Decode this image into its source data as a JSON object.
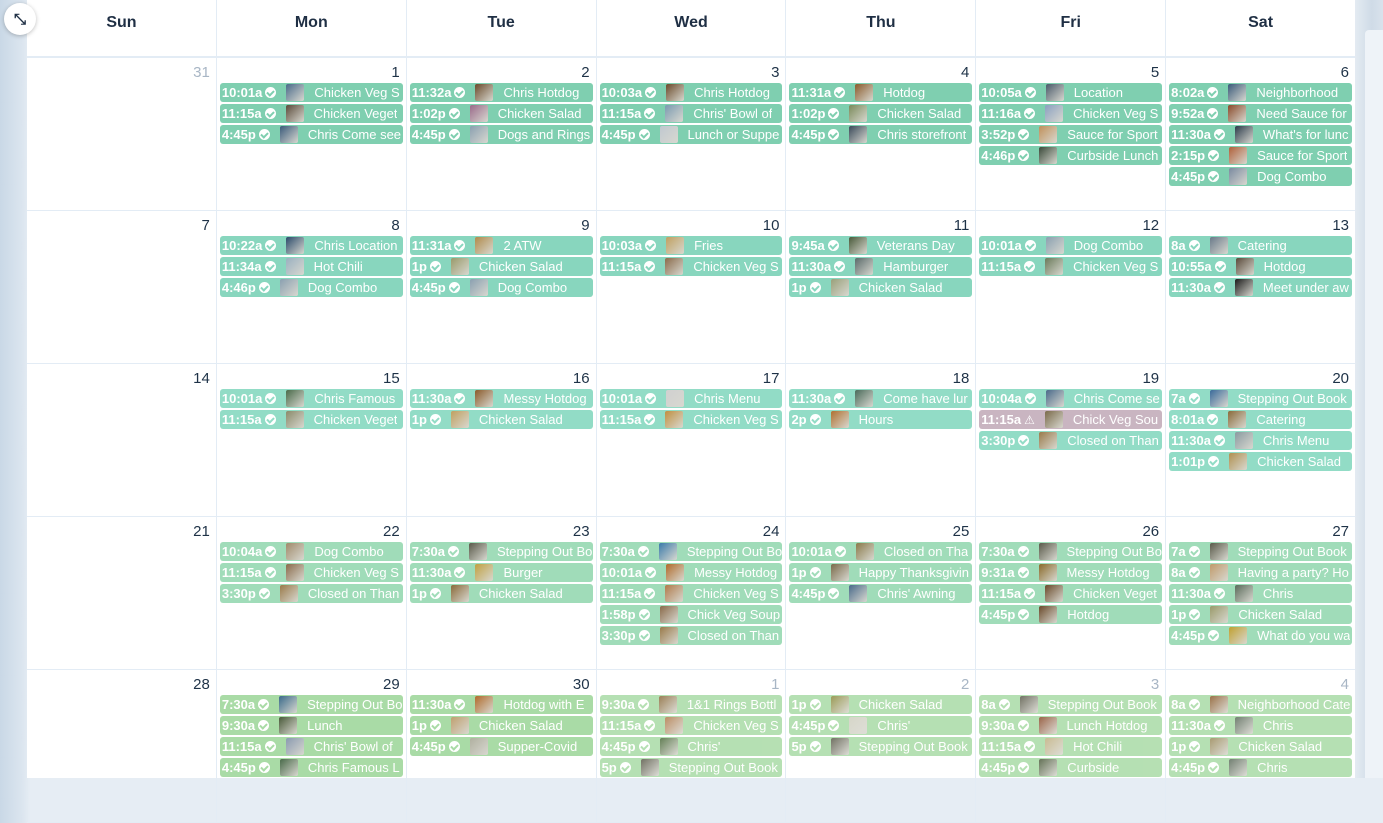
{
  "weekdays": [
    "Sun",
    "Mon",
    "Tue",
    "Wed",
    "Thu",
    "Fri",
    "Sat"
  ],
  "expand_icon": "⤡",
  "colors": {
    "week1": "#7fcfb0",
    "week2": "#88d6be",
    "week3": "#92dcc6",
    "week4": "#a0dcb9",
    "week5": "#a9dba6",
    "warning": "#c9b5c1"
  },
  "weeks": [
    {
      "days": [
        {
          "num": "31",
          "other": true,
          "events": []
        },
        {
          "num": "1",
          "events": [
            {
              "time": "10:01a",
              "status": "ok",
              "name": "Chicken Veg S",
              "thumb": "#4a6a8a"
            },
            {
              "time": "11:15a",
              "status": "ok",
              "name": "Chicken Veget",
              "thumb": "#5a4a3a"
            },
            {
              "time": "4:45p",
              "status": "ok",
              "name": "Chris Come see",
              "thumb": "#3a5a7a"
            }
          ]
        },
        {
          "num": "2",
          "events": [
            {
              "time": "11:32a",
              "status": "ok",
              "name": "Chris Hotdog",
              "thumb": "#6a4a2a"
            },
            {
              "time": "1:02p",
              "status": "ok",
              "name": "Chicken Salad",
              "thumb": "#9a6a8a"
            },
            {
              "time": "4:45p",
              "status": "ok",
              "name": "Dogs and Rings",
              "thumb": "#8aa0b0"
            }
          ]
        },
        {
          "num": "3",
          "events": [
            {
              "time": "10:03a",
              "status": "ok",
              "name": "Chris Hotdog",
              "thumb": "#6a4a2a"
            },
            {
              "time": "11:15a",
              "status": "ok",
              "name": "Chris' Bowl of",
              "thumb": "#7a9ab0"
            },
            {
              "time": "4:45p",
              "status": "ok",
              "name": "Lunch or Suppe",
              "thumb": "#c0c8d0"
            }
          ]
        },
        {
          "num": "4",
          "events": [
            {
              "time": "11:31a",
              "status": "ok",
              "name": "Hotdog",
              "thumb": "#8a5a2a"
            },
            {
              "time": "1:02p",
              "status": "ok",
              "name": "Chicken Salad",
              "thumb": "#7a8a5a"
            },
            {
              "time": "4:45p",
              "status": "ok",
              "name": "Chris storefront",
              "thumb": "#3a4a5a"
            }
          ]
        },
        {
          "num": "5",
          "events": [
            {
              "time": "10:05a",
              "status": "ok",
              "name": "Location",
              "thumb": "#4a5a6a"
            },
            {
              "time": "11:16a",
              "status": "ok",
              "name": "Chicken Veg S",
              "thumb": "#8aa0c0"
            },
            {
              "time": "3:52p",
              "status": "ok",
              "name": "Sauce for Sport",
              "thumb": "#c0905a"
            },
            {
              "time": "4:46p",
              "status": "ok",
              "name": "Curbside Lunch",
              "thumb": "#3a4a3a"
            }
          ]
        },
        {
          "num": "6",
          "events": [
            {
              "time": "8:02a",
              "status": "ok",
              "name": "Neighborhood",
              "thumb": "#3a5a7a"
            },
            {
              "time": "9:52a",
              "status": "ok",
              "name": "Need Sauce for",
              "thumb": "#8a4a2a"
            },
            {
              "time": "11:30a",
              "status": "ok",
              "name": "What's for lunc",
              "thumb": "#2a3a4a"
            },
            {
              "time": "2:15p",
              "status": "ok",
              "name": "Sauce for Sport",
              "thumb": "#b0603a"
            },
            {
              "time": "4:45p",
              "status": "ok",
              "name": "Dog Combo",
              "thumb": "#7a8aa0"
            }
          ]
        }
      ]
    },
    {
      "days": [
        {
          "num": "7",
          "events": []
        },
        {
          "num": "8",
          "events": [
            {
              "time": "10:22a",
              "status": "ok",
              "name": "Chris Location",
              "thumb": "#2a4a6a"
            },
            {
              "time": "11:34a",
              "status": "ok",
              "name": "Hot Chili",
              "thumb": "#9ab0c0"
            },
            {
              "time": "4:46p",
              "status": "ok",
              "name": "Dog Combo",
              "thumb": "#8aa0b0"
            }
          ]
        },
        {
          "num": "9",
          "events": [
            {
              "time": "11:31a",
              "status": "ok",
              "name": "2 ATW",
              "thumb": "#b08a4a"
            },
            {
              "time": "1p",
              "status": "ok",
              "name": "Chicken Salad",
              "thumb": "#9a9a6a"
            },
            {
              "time": "4:45p",
              "status": "ok",
              "name": "Dog Combo",
              "thumb": "#8aa0b0"
            }
          ]
        },
        {
          "num": "10",
          "events": [
            {
              "time": "10:03a",
              "status": "ok",
              "name": "Fries",
              "thumb": "#c0a060"
            },
            {
              "time": "11:15a",
              "status": "ok",
              "name": "Chicken Veg S",
              "thumb": "#8a6a4a"
            }
          ]
        },
        {
          "num": "11",
          "events": [
            {
              "time": "9:45a",
              "status": "ok",
              "name": "Veterans Day",
              "thumb": "#4a5a3a"
            },
            {
              "time": "11:30a",
              "status": "ok",
              "name": "Hamburger",
              "thumb": "#5a6a6a"
            },
            {
              "time": "1p",
              "status": "ok",
              "name": "Chicken Salad",
              "thumb": "#9aa07a"
            }
          ]
        },
        {
          "num": "12",
          "events": [
            {
              "time": "10:01a",
              "status": "ok",
              "name": "Dog Combo",
              "thumb": "#8aa0b0"
            },
            {
              "time": "11:15a",
              "status": "ok",
              "name": "Chicken Veg S",
              "thumb": "#6a7a5a"
            }
          ]
        },
        {
          "num": "13",
          "events": [
            {
              "time": "8a",
              "status": "ok",
              "name": "Catering",
              "thumb": "#6a7a8a"
            },
            {
              "time": "10:55a",
              "status": "ok",
              "name": "Hotdog",
              "thumb": "#5a4a3a"
            },
            {
              "time": "11:30a",
              "status": "ok",
              "name": "Meet under aw",
              "thumb": "#1a1a1a"
            }
          ]
        }
      ]
    },
    {
      "days": [
        {
          "num": "14",
          "events": []
        },
        {
          "num": "15",
          "events": [
            {
              "time": "10:01a",
              "status": "ok",
              "name": "Chris Famous",
              "thumb": "#4a6a4a"
            },
            {
              "time": "11:15a",
              "status": "ok",
              "name": "Chicken Veget",
              "thumb": "#8a8a6a"
            }
          ]
        },
        {
          "num": "16",
          "events": [
            {
              "time": "11:30a",
              "status": "ok",
              "name": "Messy Hotdog",
              "thumb": "#8a5a2a"
            },
            {
              "time": "1p",
              "status": "ok",
              "name": "Chicken Salad",
              "thumb": "#c0a060"
            }
          ]
        },
        {
          "num": "17",
          "events": [
            {
              "time": "10:01a",
              "status": "ok",
              "name": "Chris Menu",
              "thumb": "#d0d0d0"
            },
            {
              "time": "11:15a",
              "status": "ok",
              "name": "Chicken Veg S",
              "thumb": "#c09040"
            }
          ]
        },
        {
          "num": "18",
          "events": [
            {
              "time": "11:30a",
              "status": "ok",
              "name": "Come have lur",
              "thumb": "#4a6a5a"
            },
            {
              "time": "2p",
              "status": "ok",
              "name": "Hours",
              "thumb": "#b07030"
            }
          ]
        },
        {
          "num": "19",
          "events": [
            {
              "time": "10:04a",
              "status": "ok",
              "name": "Chris Come se",
              "thumb": "#4a6a8a"
            },
            {
              "time": "11:15a",
              "status": "warn",
              "name": "Chick Veg Sou",
              "thumb": "#7a6a4a"
            },
            {
              "time": "3:30p",
              "status": "ok",
              "name": "Closed on Than",
              "thumb": "#9a7a4a"
            }
          ]
        },
        {
          "num": "20",
          "events": [
            {
              "time": "7a",
              "status": "ok",
              "name": "Stepping Out Book",
              "thumb": "#3a6a9a"
            },
            {
              "time": "8:01a",
              "status": "ok",
              "name": "Catering",
              "thumb": "#8a6a3a"
            },
            {
              "time": "11:30a",
              "status": "ok",
              "name": "Chris Menu",
              "thumb": "#8a9aa0"
            },
            {
              "time": "1:01p",
              "status": "ok",
              "name": "Chicken Salad",
              "thumb": "#b09050"
            }
          ]
        }
      ]
    },
    {
      "days": [
        {
          "num": "21",
          "events": []
        },
        {
          "num": "22",
          "events": [
            {
              "time": "10:04a",
              "status": "ok",
              "name": "Dog Combo",
              "thumb": "#a08a6a"
            },
            {
              "time": "11:15a",
              "status": "ok",
              "name": "Chicken Veg S",
              "thumb": "#8a6a4a"
            },
            {
              "time": "3:30p",
              "status": "ok",
              "name": "Closed on Than",
              "thumb": "#9a7a4a"
            }
          ]
        },
        {
          "num": "23",
          "events": [
            {
              "time": "7:30a",
              "status": "ok",
              "name": "Stepping Out Bo",
              "thumb": "#5a5a4a"
            },
            {
              "time": "11:30a",
              "status": "ok",
              "name": "Burger",
              "thumb": "#c0a040"
            },
            {
              "time": "1p",
              "status": "ok",
              "name": "Chicken Salad",
              "thumb": "#8a6a3a"
            }
          ]
        },
        {
          "num": "24",
          "events": [
            {
              "time": "7:30a",
              "status": "ok",
              "name": "Stepping Out Bo",
              "thumb": "#3a7aaa"
            },
            {
              "time": "10:01a",
              "status": "ok",
              "name": "Messy Hotdog",
              "thumb": "#b06a2a"
            },
            {
              "time": "11:15a",
              "status": "ok",
              "name": "Chicken Veg S",
              "thumb": "#b07a4a"
            },
            {
              "time": "1:58p",
              "status": "ok",
              "name": "Chick Veg Soup",
              "thumb": "#8a6a4a"
            },
            {
              "time": "3:30p",
              "status": "ok",
              "name": "Closed on Than",
              "thumb": "#9a7a4a"
            }
          ]
        },
        {
          "num": "25",
          "events": [
            {
              "time": "10:01a",
              "status": "ok",
              "name": "Closed on Tha",
              "thumb": "#8a7a4a"
            },
            {
              "time": "1p",
              "status": "ok",
              "name": "Happy Thanksgivin",
              "thumb": "#7a6a4a"
            },
            {
              "time": "4:45p",
              "status": "ok",
              "name": "Chris' Awning",
              "thumb": "#4a6a8a"
            }
          ]
        },
        {
          "num": "26",
          "events": [
            {
              "time": "7:30a",
              "status": "ok",
              "name": "Stepping Out Bo",
              "thumb": "#5a5a4a"
            },
            {
              "time": "9:31a",
              "status": "ok",
              "name": "Messy Hotdog",
              "thumb": "#8a6a2a"
            },
            {
              "time": "11:15a",
              "status": "ok",
              "name": "Chicken Veget",
              "thumb": "#6a4a2a"
            },
            {
              "time": "4:45p",
              "status": "ok",
              "name": "Hotdog",
              "thumb": "#6a4a2a"
            }
          ]
        },
        {
          "num": "27",
          "events": [
            {
              "time": "7a",
              "status": "ok",
              "name": "Stepping Out Book",
              "thumb": "#5a5a4a"
            },
            {
              "time": "8a",
              "status": "ok",
              "name": "Having a party? Ho",
              "thumb": "#c09a6a"
            },
            {
              "time": "11:30a",
              "status": "ok",
              "name": "Chris",
              "thumb": "#5a6a5a"
            },
            {
              "time": "1p",
              "status": "ok",
              "name": "Chicken Salad",
              "thumb": "#9a9a6a"
            },
            {
              "time": "4:45p",
              "status": "ok",
              "name": "What do you wa",
              "thumb": "#c0a030"
            }
          ]
        }
      ]
    },
    {
      "days": [
        {
          "num": "28",
          "events": []
        },
        {
          "num": "29",
          "events": [
            {
              "time": "7:30a",
              "status": "ok",
              "name": "Stepping Out Bo",
              "thumb": "#3a6a8a"
            },
            {
              "time": "9:30a",
              "status": "ok",
              "name": "Lunch",
              "thumb": "#4a5a3a"
            },
            {
              "time": "11:15a",
              "status": "ok",
              "name": "Chris' Bowl of",
              "thumb": "#8a9ab0"
            },
            {
              "time": "4:45p",
              "status": "ok",
              "name": "Chris Famous L",
              "thumb": "#4a6a4a"
            }
          ]
        },
        {
          "num": "30",
          "events": [
            {
              "time": "11:30a",
              "status": "ok",
              "name": "Hotdog with E",
              "thumb": "#b06a2a"
            },
            {
              "time": "1p",
              "status": "ok",
              "name": "Chicken Salad",
              "thumb": "#c0a070"
            },
            {
              "time": "4:45p",
              "status": "ok",
              "name": "Supper-Covid",
              "thumb": "#b0b0a0"
            }
          ]
        },
        {
          "num": "1",
          "other": true,
          "events": [
            {
              "time": "9:30a",
              "status": "ok",
              "name": "1&1 Rings Bottl",
              "thumb": "#8a6a3a"
            },
            {
              "time": "11:15a",
              "status": "ok",
              "name": "Chicken Veg S",
              "thumb": "#b07a4a"
            },
            {
              "time": "4:45p",
              "status": "ok",
              "name": "Chris'",
              "thumb": "#4a6a3a"
            },
            {
              "time": "5p",
              "status": "ok",
              "name": "Stepping Out Book",
              "thumb": "#5a5a4a"
            }
          ]
        },
        {
          "num": "2",
          "other": true,
          "events": [
            {
              "time": "1p",
              "status": "ok",
              "name": "Chicken Salad",
              "thumb": "#8a8a3a"
            },
            {
              "time": "4:45p",
              "status": "ok",
              "name": "Chris'",
              "thumb": "#d0d0c0"
            },
            {
              "time": "5p",
              "status": "ok",
              "name": "Stepping Out Book",
              "thumb": "#5a5a4a"
            }
          ]
        },
        {
          "num": "3",
          "other": true,
          "events": [
            {
              "time": "8a",
              "status": "ok",
              "name": "Stepping Out Book",
              "thumb": "#5a5a4a"
            },
            {
              "time": "9:30a",
              "status": "ok",
              "name": "Lunch Hotdog",
              "thumb": "#8a4a2a"
            },
            {
              "time": "11:15a",
              "status": "ok",
              "name": "Hot Chili",
              "thumb": "#c0b080"
            },
            {
              "time": "4:45p",
              "status": "ok",
              "name": "Curbside",
              "thumb": "#4a5a3a"
            }
          ]
        },
        {
          "num": "4",
          "other": true,
          "events": [
            {
              "time": "8a",
              "status": "ok",
              "name": "Neighborhood Cate",
              "thumb": "#8a5a2a"
            },
            {
              "time": "11:30a",
              "status": "ok",
              "name": "Chris",
              "thumb": "#5a6a5a"
            },
            {
              "time": "1p",
              "status": "ok",
              "name": "Chicken Salad",
              "thumb": "#9a8a5a"
            },
            {
              "time": "4:45p",
              "status": "ok",
              "name": "Chris",
              "thumb": "#5a6a5a"
            }
          ]
        }
      ]
    }
  ]
}
